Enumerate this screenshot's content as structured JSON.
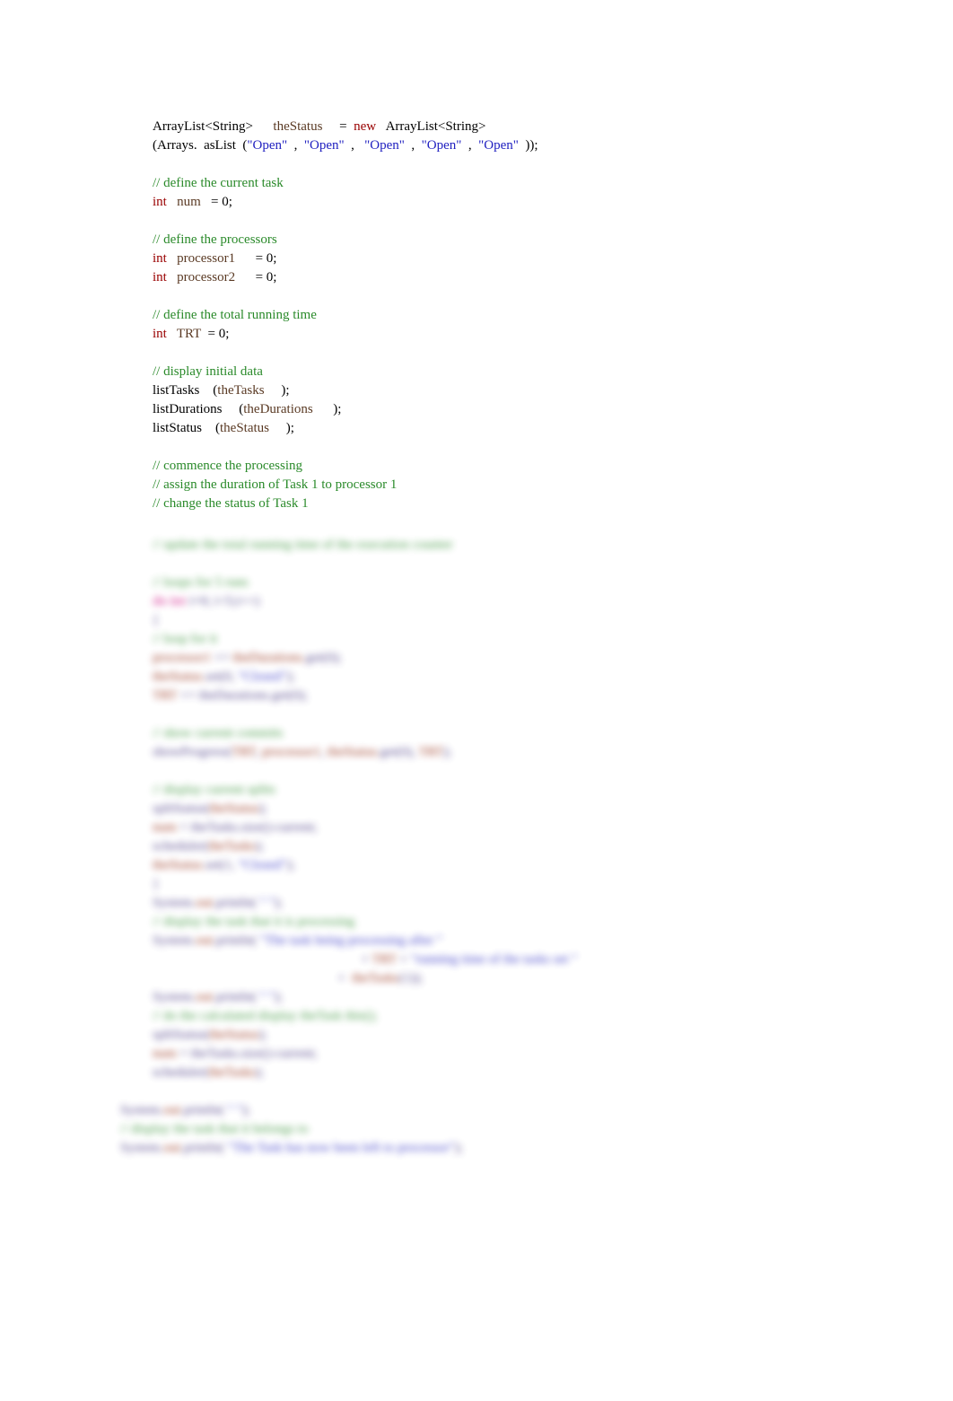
{
  "code": {
    "line1_a": "ArrayList<String>      ",
    "line1_b": "theStatus",
    "line1_c": "     =  ",
    "line1_d": "new",
    "line1_e": "   ArrayList<String>",
    "line2_a": "(Arrays.  asList  (",
    "line2_b": "\"Open\"",
    "line2_c": "  ,  ",
    "line2_d": "\"Open\"",
    "line2_e": "  ,   ",
    "line2_f": "\"Open\"",
    "line2_g": "  ,  ",
    "line2_h": "\"Open\"",
    "line2_i": "  ,  ",
    "line2_j": "\"Open\"",
    "line2_k": "  ));",
    "cm1": "// define the current task",
    "line3_a": "int",
    "line3_b": "   num",
    "line3_c": "   = 0;",
    "cm2": "// define the processors",
    "line4_a": "int",
    "line4_b": "   processor1",
    "line4_c": "      = 0;",
    "line5_a": "int",
    "line5_b": "   processor2",
    "line5_c": "      = 0;",
    "cm3": "// define the total running time",
    "line6_a": "int",
    "line6_b": "   TRT",
    "line6_c": "  = 0;",
    "cm4": "// display initial data",
    "line7_a": "listTasks    (",
    "line7_b": "theTasks",
    "line7_c": "     );",
    "line8_a": "listDurations     (",
    "line8_b": "theDurations",
    "line8_c": "      );",
    "line9_a": "listStatus    (",
    "line9_b": "theStatus",
    "line9_c": "     );",
    "cm5": "// commence the processing",
    "cm6": "// assign the duration of Task 1 to processor 1",
    "cm7": "// change the status of Task 1"
  },
  "blur": {
    "b1": "// update the total running time of the execution counter",
    "b2": "// loops for 5 runs",
    "b3_a": "do ",
    "b3_b": "int",
    "b3_c": " i=0; i<5;i++)",
    "b4": "{",
    "b5": "// loop for it",
    "b6_a": "processor1 ",
    "b6_b": "+= ",
    "b6_c": "theDurations.",
    "b6_d": "get(0);",
    "b7_a": "theStatus.",
    "b7_b": "set(",
    "b7_c": "0",
    "b7_d": ", ",
    "b7_e": "\"Closed\"",
    "b7_f": ");",
    "b8_a": "TRT ",
    "b8_b": "+= theDurations.",
    "b8_c": "get(0);",
    "b9": "// show current commits",
    "b10_a": "showProgress(",
    "b10_b": "TRT",
    "b10_c": ", ",
    "b10_d": "processor1",
    "b10_e": ", ",
    "b10_f": "theStatus.",
    "b10_g": "get(0)",
    "b10_h": ", ",
    "b10_i": "TRT",
    "b10_j": ");",
    "b11": "// display current splits",
    "b12_a": "spltStatus(",
    "b12_b": "theStatus",
    "b12_c": ");",
    "b13_a": "num",
    "b13_b": " = theTasks.",
    "b13_c": "size()",
    "b13_d": "-current;",
    "b14_a": "scheduler(",
    "b14_b": "theTasks",
    "b14_c": ");",
    "b15_a": "theStatus.",
    "b15_b": "set(",
    "b15_c": "1",
    "b15_d": ", ",
    "b15_e": "\"Closed\"",
    "b15_f": ");",
    "b16": "}",
    "b17_a": "System.",
    "b17_b": "out",
    "b17_c": ".println(",
    "b17_d": " \" \"",
    "b17_e": ");",
    "b18": "// display the task that it is processing",
    "b19_a": "System.",
    "b19_b": "out",
    "b19_c": ".println(",
    "b19_d": " \"The task being processing after \"",
    "b20_a": "                                                              + ",
    "b20_b": "TRT",
    "b20_c": " + ",
    "b20_d": "\"running time of the tasks set \"",
    "b21_a": "                                                       + ",
    "b21_b": " theTasks",
    "b21_c": "(",
    "b21_d": "1",
    "b21_e": "));",
    "b22_a": "System.",
    "b22_b": "out",
    "b22_c": ".println(",
    "b22_d": " \" \"",
    "b22_e": ");",
    "b23": "// do the calculated display theTask this();",
    "b24_a": "spltStatus(",
    "b24_b": "theStatus",
    "b24_c": ");",
    "b25_a": "num",
    "b25_b": " = theTasks.",
    "b25_c": "size()",
    "b25_d": "-current;",
    "b26_a": "scheduler(",
    "b26_b": "theTasks",
    "b26_c": ");",
    "b27_a": "System.",
    "b27_b": "out",
    "b27_c": ".println(",
    "b27_d": " \" \"",
    "b27_e": ");",
    "b28": "// display the task that it belongs to",
    "b29_a": "System.",
    "b29_b": "out",
    "b29_c": ".println(",
    "b29_d": " \"The Task has now been left to processor\"",
    "b29_e": ");"
  }
}
